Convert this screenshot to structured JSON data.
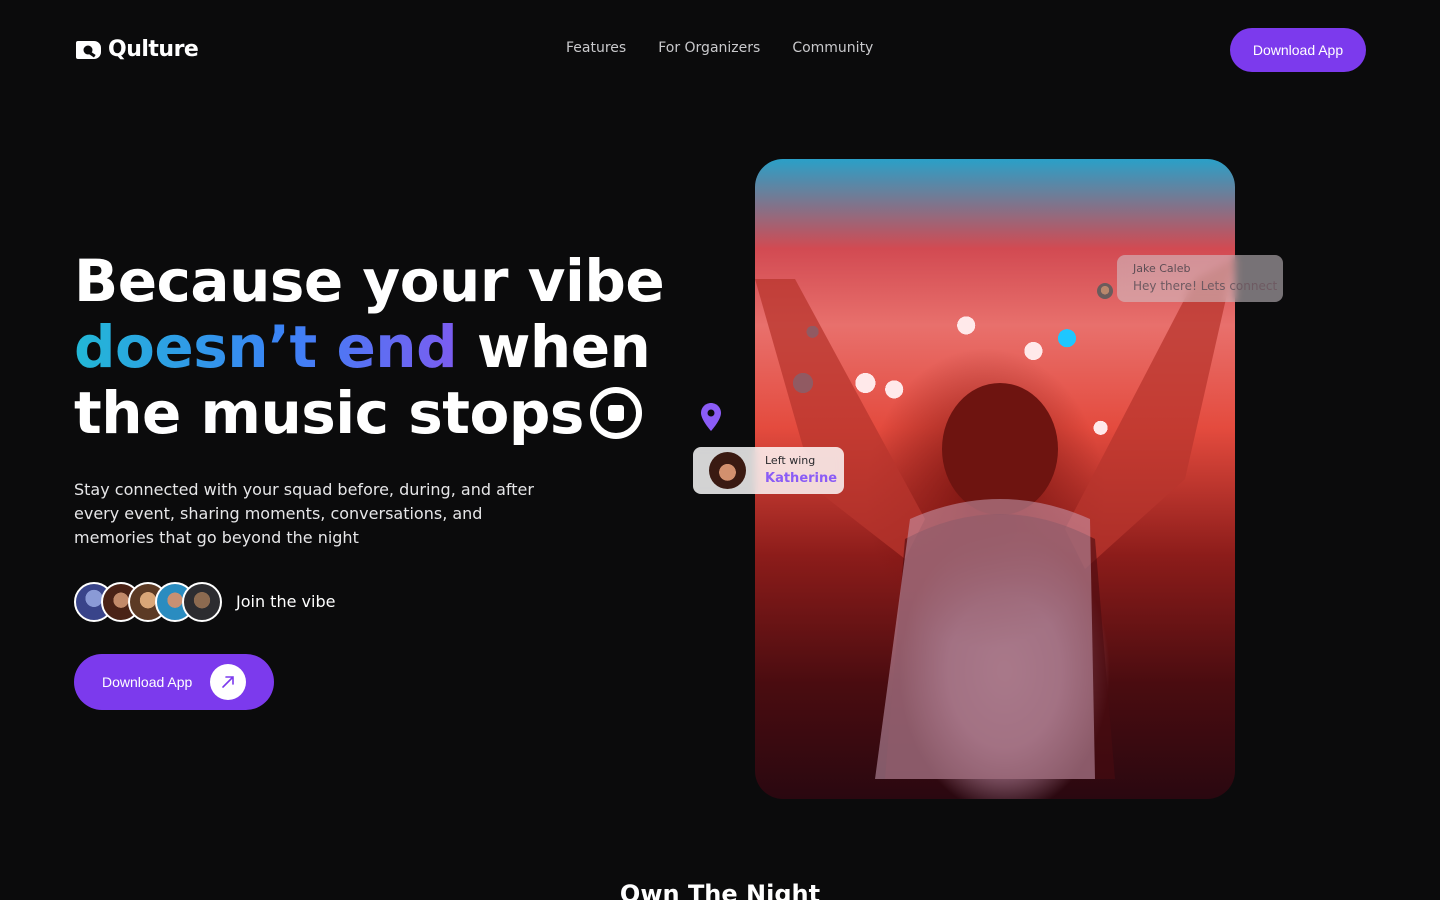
{
  "nav": {
    "brand": "Qulture",
    "links": [
      "Features",
      "For Organizers",
      "Community"
    ],
    "cta_label": "Download App"
  },
  "hero": {
    "headline_line1": "Because your vibe",
    "headline_grad": "doesn’t end",
    "headline_line2_rest": " when",
    "headline_line3": "the music stops",
    "subtext": "Stay connected with your squad before, during, and after every event, sharing moments, conversations, and memories that go beyond the night",
    "join_label": "Join the vibe",
    "cta_label": "Download App",
    "colors": {
      "accent": "#7c3aed",
      "gradient_start": "#22b8d6",
      "gradient_end": "#7c5cf0"
    }
  },
  "photo_card": {
    "chip_left": {
      "caption": "Left wing",
      "name": "Katherine"
    },
    "chip_right": {
      "name": "Jake Caleb",
      "message": "Hey there! Lets connect"
    }
  },
  "next_section": {
    "title": "Own The Night"
  }
}
